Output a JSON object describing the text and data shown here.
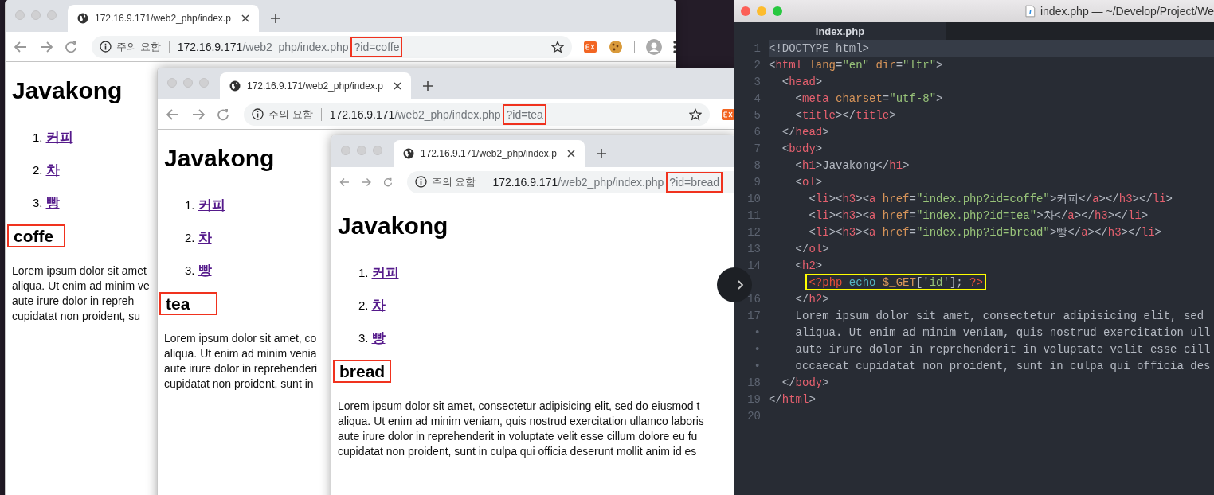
{
  "browsers": [
    {
      "tab_title": "172.16.9.171/web2_php/index.p",
      "security_label": "주의 요함",
      "host": "172.16.9.171",
      "path": "/web2_php/index.php",
      "query": "?id=coffe",
      "heading": "Javakong",
      "links": [
        {
          "number": "1.",
          "label": "커피"
        },
        {
          "number": "2.",
          "label": "차"
        },
        {
          "number": "3.",
          "label": "빵"
        }
      ],
      "result": "coffe",
      "paragraph_lines": [
        "Lorem ipsum dolor sit amet",
        "aliqua. Ut enim ad minim ve",
        "aute irure dolor in repreh",
        "cupidatat non proident, su"
      ]
    },
    {
      "tab_title": "172.16.9.171/web2_php/index.p",
      "security_label": "주의 요함",
      "host": "172.16.9.171",
      "path": "/web2_php/index.php",
      "query": "?id=tea",
      "heading": "Javakong",
      "links": [
        {
          "number": "1.",
          "label": "커피"
        },
        {
          "number": "2.",
          "label": "차"
        },
        {
          "number": "3.",
          "label": "빵"
        }
      ],
      "result": "tea",
      "paragraph_lines": [
        "Lorem ipsum dolor sit amet, co",
        "aliqua. Ut enim ad minim venia",
        "aute irure dolor in reprehenderi",
        "cupidatat non proident, sunt in"
      ]
    },
    {
      "tab_title": "172.16.9.171/web2_php/index.p",
      "security_label": "주의 요함",
      "host": "172.16.9.171",
      "path": "/web2_php/index.php",
      "query": "?id=bread",
      "heading": "Javakong",
      "links": [
        {
          "number": "1.",
          "label": "커피"
        },
        {
          "number": "2.",
          "label": "차"
        },
        {
          "number": "3.",
          "label": "빵"
        }
      ],
      "result": "bread",
      "paragraph_lines": [
        "Lorem ipsum dolor sit amet, consectetur adipisicing elit, sed do eiusmod t",
        "aliqua. Ut enim ad minim veniam, quis nostrud exercitation ullamco laboris",
        "aute irure dolor in reprehenderit in voluptate velit esse cillum dolore eu fu",
        "cupidatat non proident, sunt in culpa qui officia deserunt mollit anim id es"
      ]
    }
  ],
  "editor": {
    "title": "index.php — ~/Develop/Project/We",
    "tab": "index.php",
    "lines": [
      {
        "gutter": "1",
        "current": true,
        "highlighted": false,
        "tokens": [
          {
            "kind": "text",
            "text": "<!DOCTYPE html>"
          }
        ]
      },
      {
        "gutter": "2",
        "current": false,
        "highlighted": false,
        "tokens": [
          {
            "kind": "punct",
            "text": "<"
          },
          {
            "kind": "tag",
            "text": "html"
          },
          {
            "kind": "attr",
            "text": " lang"
          },
          {
            "kind": "punct",
            "text": "="
          },
          {
            "kind": "string",
            "text": "\"en\""
          },
          {
            "kind": "attr",
            "text": " dir"
          },
          {
            "kind": "punct",
            "text": "="
          },
          {
            "kind": "string",
            "text": "\"ltr\""
          },
          {
            "kind": "punct",
            "text": ">"
          }
        ]
      },
      {
        "gutter": "3",
        "current": false,
        "highlighted": false,
        "tokens": [
          {
            "kind": "punct",
            "text": "  <"
          },
          {
            "kind": "tag",
            "text": "head"
          },
          {
            "kind": "punct",
            "text": ">"
          }
        ]
      },
      {
        "gutter": "4",
        "current": false,
        "highlighted": false,
        "tokens": [
          {
            "kind": "punct",
            "text": "    <"
          },
          {
            "kind": "tag",
            "text": "meta"
          },
          {
            "kind": "attr",
            "text": " charset"
          },
          {
            "kind": "punct",
            "text": "="
          },
          {
            "kind": "string",
            "text": "\"utf-8\""
          },
          {
            "kind": "punct",
            "text": ">"
          }
        ]
      },
      {
        "gutter": "5",
        "current": false,
        "highlighted": false,
        "tokens": [
          {
            "kind": "punct",
            "text": "    <"
          },
          {
            "kind": "tag",
            "text": "title"
          },
          {
            "kind": "punct",
            "text": "></"
          },
          {
            "kind": "tag",
            "text": "title"
          },
          {
            "kind": "punct",
            "text": ">"
          }
        ]
      },
      {
        "gutter": "6",
        "current": false,
        "highlighted": false,
        "tokens": [
          {
            "kind": "punct",
            "text": "  </"
          },
          {
            "kind": "tag",
            "text": "head"
          },
          {
            "kind": "punct",
            "text": ">"
          }
        ]
      },
      {
        "gutter": "7",
        "current": false,
        "highlighted": false,
        "tokens": [
          {
            "kind": "punct",
            "text": "  <"
          },
          {
            "kind": "tag",
            "text": "body"
          },
          {
            "kind": "punct",
            "text": ">"
          }
        ]
      },
      {
        "gutter": "8",
        "current": false,
        "highlighted": false,
        "tokens": [
          {
            "kind": "punct",
            "text": "    <"
          },
          {
            "kind": "tag",
            "text": "h1"
          },
          {
            "kind": "punct",
            "text": ">Javakong</"
          },
          {
            "kind": "tag",
            "text": "h1"
          },
          {
            "kind": "punct",
            "text": ">"
          }
        ]
      },
      {
        "gutter": "9",
        "current": false,
        "highlighted": false,
        "tokens": [
          {
            "kind": "punct",
            "text": "    <"
          },
          {
            "kind": "tag",
            "text": "ol"
          },
          {
            "kind": "punct",
            "text": ">"
          }
        ]
      },
      {
        "gutter": "10",
        "current": false,
        "highlighted": false,
        "tokens": [
          {
            "kind": "punct",
            "text": "      <"
          },
          {
            "kind": "tag",
            "text": "li"
          },
          {
            "kind": "punct",
            "text": "><"
          },
          {
            "kind": "tag",
            "text": "h3"
          },
          {
            "kind": "punct",
            "text": "><"
          },
          {
            "kind": "tag",
            "text": "a"
          },
          {
            "kind": "attr",
            "text": " href"
          },
          {
            "kind": "punct",
            "text": "="
          },
          {
            "kind": "string",
            "text": "\"index.php?id=coffe\""
          },
          {
            "kind": "punct",
            "text": ">커피</"
          },
          {
            "kind": "tag",
            "text": "a"
          },
          {
            "kind": "punct",
            "text": "></"
          },
          {
            "kind": "tag",
            "text": "h3"
          },
          {
            "kind": "punct",
            "text": "></"
          },
          {
            "kind": "tag",
            "text": "li"
          },
          {
            "kind": "punct",
            "text": ">"
          }
        ]
      },
      {
        "gutter": "11",
        "current": false,
        "highlighted": false,
        "tokens": [
          {
            "kind": "punct",
            "text": "      <"
          },
          {
            "kind": "tag",
            "text": "li"
          },
          {
            "kind": "punct",
            "text": "><"
          },
          {
            "kind": "tag",
            "text": "h3"
          },
          {
            "kind": "punct",
            "text": "><"
          },
          {
            "kind": "tag",
            "text": "a"
          },
          {
            "kind": "attr",
            "text": " href"
          },
          {
            "kind": "punct",
            "text": "="
          },
          {
            "kind": "string",
            "text": "\"index.php?id=tea\""
          },
          {
            "kind": "punct",
            "text": ">차</"
          },
          {
            "kind": "tag",
            "text": "a"
          },
          {
            "kind": "punct",
            "text": "></"
          },
          {
            "kind": "tag",
            "text": "h3"
          },
          {
            "kind": "punct",
            "text": "></"
          },
          {
            "kind": "tag",
            "text": "li"
          },
          {
            "kind": "punct",
            "text": ">"
          }
        ]
      },
      {
        "gutter": "12",
        "current": false,
        "highlighted": false,
        "tokens": [
          {
            "kind": "punct",
            "text": "      <"
          },
          {
            "kind": "tag",
            "text": "li"
          },
          {
            "kind": "punct",
            "text": "><"
          },
          {
            "kind": "tag",
            "text": "h3"
          },
          {
            "kind": "punct",
            "text": "><"
          },
          {
            "kind": "tag",
            "text": "a"
          },
          {
            "kind": "attr",
            "text": " href"
          },
          {
            "kind": "punct",
            "text": "="
          },
          {
            "kind": "string",
            "text": "\"index.php?id=bread\""
          },
          {
            "kind": "punct",
            "text": ">빵</"
          },
          {
            "kind": "tag",
            "text": "a"
          },
          {
            "kind": "punct",
            "text": "></"
          },
          {
            "kind": "tag",
            "text": "h3"
          },
          {
            "kind": "punct",
            "text": "></"
          },
          {
            "kind": "tag",
            "text": "li"
          },
          {
            "kind": "punct",
            "text": ">"
          }
        ]
      },
      {
        "gutter": "13",
        "current": false,
        "highlighted": false,
        "tokens": [
          {
            "kind": "punct",
            "text": "    </"
          },
          {
            "kind": "tag",
            "text": "ol"
          },
          {
            "kind": "punct",
            "text": ">"
          }
        ]
      },
      {
        "gutter": "14",
        "current": false,
        "highlighted": false,
        "tokens": [
          {
            "kind": "punct",
            "text": "    <"
          },
          {
            "kind": "tag",
            "text": "h2"
          },
          {
            "kind": "punct",
            "text": ">"
          }
        ]
      },
      {
        "current": false,
        "highlighted": true,
        "tokens": [
          {
            "kind": "php",
            "text": "      <?php"
          },
          {
            "kind": "keyword",
            "text": " echo"
          },
          {
            "kind": "variable",
            "text": " $_GET"
          },
          {
            "kind": "punct",
            "text": "['"
          },
          {
            "kind": "string",
            "text": "id"
          },
          {
            "kind": "punct",
            "text": "'];"
          },
          {
            "kind": "php",
            "text": " ?>"
          }
        ]
      },
      {
        "gutter": "16",
        "current": false,
        "highlighted": false,
        "tokens": [
          {
            "kind": "punct",
            "text": "    </"
          },
          {
            "kind": "tag",
            "text": "h2"
          },
          {
            "kind": "punct",
            "text": ">"
          }
        ]
      },
      {
        "gutter": "17",
        "current": false,
        "highlighted": false,
        "tokens": [
          {
            "kind": "text",
            "text": "    Lorem ipsum dolor sit amet, consectetur adipisicing elit, sed"
          }
        ]
      },
      {
        "gutter": "•",
        "current": false,
        "highlighted": false,
        "tokens": [
          {
            "kind": "text",
            "text": "    aliqua. Ut enim ad minim veniam, quis nostrud exercitation ull"
          }
        ]
      },
      {
        "gutter": "•",
        "current": false,
        "highlighted": false,
        "tokens": [
          {
            "kind": "text",
            "text": "    aute irure dolor in reprehenderit in voluptate velit esse cill"
          }
        ]
      },
      {
        "gutter": "•",
        "current": false,
        "highlighted": false,
        "tokens": [
          {
            "kind": "text",
            "text": "    occaecat cupidatat non proident, sunt in culpa qui officia des"
          }
        ]
      },
      {
        "gutter": "18",
        "current": false,
        "highlighted": false,
        "tokens": [
          {
            "kind": "punct",
            "text": "  </"
          },
          {
            "kind": "tag",
            "text": "body"
          },
          {
            "kind": "punct",
            "text": ">"
          }
        ]
      },
      {
        "gutter": "19",
        "current": false,
        "highlighted": false,
        "tokens": [
          {
            "kind": "punct",
            "text": "</"
          },
          {
            "kind": "tag",
            "text": "html"
          },
          {
            "kind": "punct",
            "text": ">"
          }
        ]
      },
      {
        "gutter": "20",
        "current": false
      }
    ]
  }
}
